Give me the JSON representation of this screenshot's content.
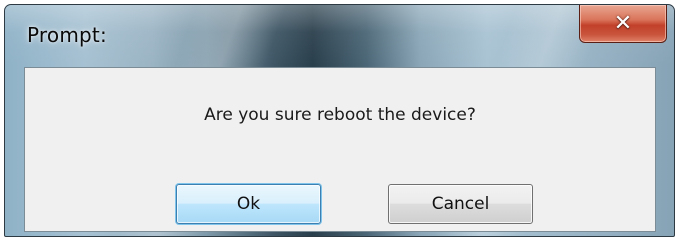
{
  "window": {
    "title": "Prompt:"
  },
  "titlebar": {
    "close_icon": "close-x-icon",
    "close_glyph": "✕",
    "close_color": "#c9553c"
  },
  "dialog": {
    "message": "Are you sure reboot the device?",
    "ok_label": "Ok",
    "cancel_label": "Cancel",
    "default_button_color": "#3c7fb1"
  }
}
